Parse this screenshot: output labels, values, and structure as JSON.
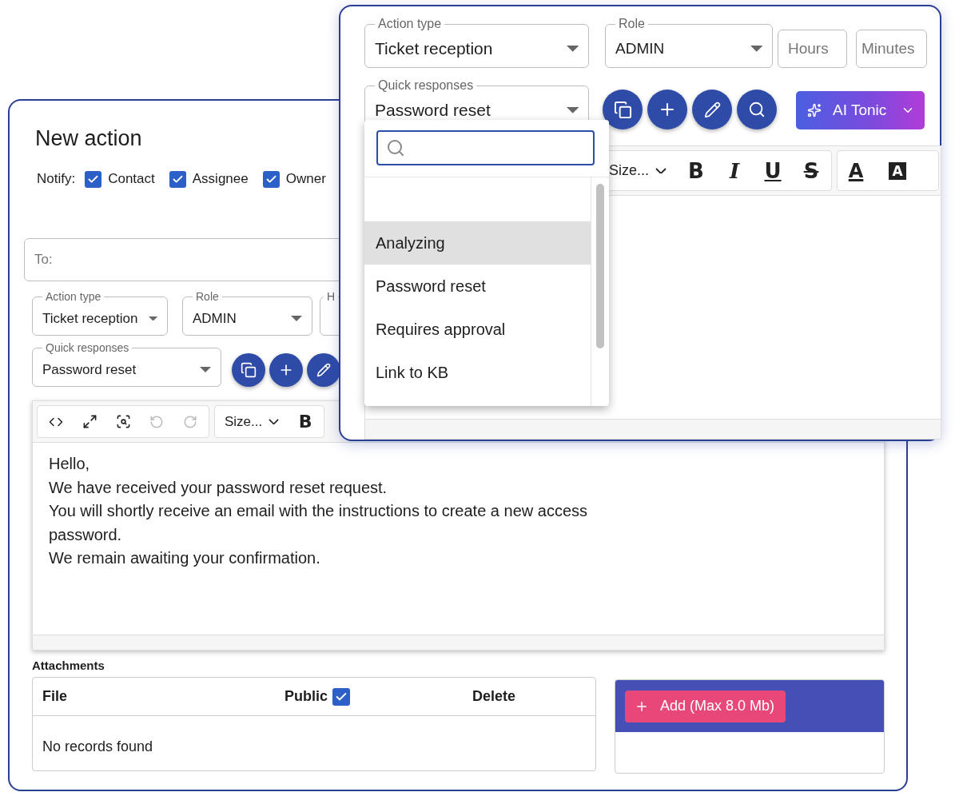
{
  "back_window": {
    "title": "New action",
    "notify": {
      "label": "Notify:",
      "options": [
        {
          "label": "Contact",
          "checked": true
        },
        {
          "label": "Assignee",
          "checked": true
        },
        {
          "label": "Owner",
          "checked": true
        }
      ]
    },
    "to_field": {
      "placeholder": "To:"
    },
    "action_type": {
      "label": "Action type",
      "value": "Ticket reception"
    },
    "role": {
      "label": "Role",
      "value": "ADMIN"
    },
    "hours": {
      "label": "H"
    },
    "quick_responses": {
      "label": "Quick responses",
      "value": "Password reset"
    },
    "editor": {
      "toolbar": {
        "undo": {
          "disabled": true
        },
        "redo": {
          "disabled": true
        },
        "size": "Size...",
        "format_buttons": [
          {
            "kind": "bold",
            "label": "B"
          }
        ]
      },
      "body": [
        "Hello,",
        "We have received your password reset request.",
        "You will shortly receive an email with the instructions to create a new access password.",
        "We remain awaiting your confirmation."
      ]
    },
    "attachments": {
      "title": "Attachments",
      "columns": [
        {
          "label": "File"
        },
        {
          "label": "Public",
          "checked": true
        },
        {
          "label": "Delete"
        }
      ],
      "empty_text": "No records found"
    },
    "add_button": {
      "label": "Add (Max 8.0 Mb)"
    }
  },
  "front_window": {
    "action_type": {
      "label": "Action type",
      "value": "Ticket reception"
    },
    "role": {
      "label": "Role",
      "value": "ADMIN"
    },
    "hours": {
      "placeholder": "Hours"
    },
    "minutes": {
      "placeholder": "Minutes"
    },
    "quick_responses": {
      "label": "Quick responses",
      "value": "Password reset",
      "dropdown": {
        "items": [
          {
            "label": "Analyzing",
            "highlighted": true
          },
          {
            "label": "Password reset",
            "highlighted": false
          },
          {
            "label": "Requires approval",
            "highlighted": false
          },
          {
            "label": "Link to KB",
            "highlighted": false
          }
        ]
      }
    },
    "ai_button": {
      "label": "AI Tonic"
    },
    "editor": {
      "toolbar": {
        "size": "Size...",
        "format_buttons": [
          {
            "kind": "bold",
            "label": "B"
          },
          {
            "kind": "italic",
            "label": "I"
          },
          {
            "kind": "underline",
            "label": "U"
          },
          {
            "kind": "strike",
            "label": "S"
          }
        ],
        "color_buttons": [
          {
            "kind": "text_color",
            "label": "A"
          },
          {
            "kind": "highlight",
            "label": "A"
          }
        ]
      }
    }
  }
}
